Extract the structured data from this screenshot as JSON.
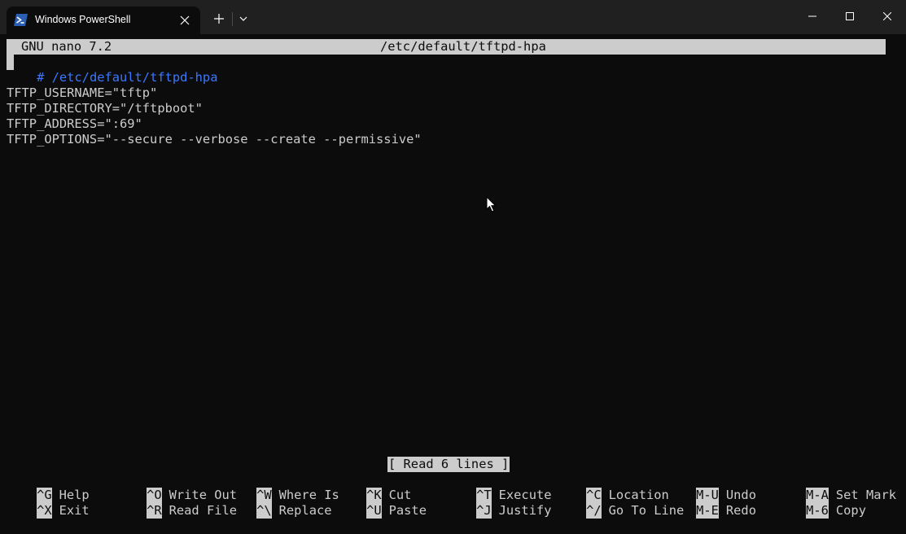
{
  "window": {
    "tab_title": "Windows PowerShell"
  },
  "nano": {
    "version": "GNU nano 7.2",
    "filename": "/etc/default/tftpd-hpa",
    "lines": [
      "# /etc/default/tftpd-hpa",
      "",
      "TFTP_USERNAME=\"tftp\"",
      "TFTP_DIRECTORY=\"/tftpboot\"",
      "TFTP_ADDRESS=\":69\"",
      "TFTP_OPTIONS=\"--secure --verbose --create --permissive\""
    ],
    "status": "[ Read 6 lines ]",
    "shortcuts_row1": [
      {
        "key": "^G",
        "label": "Help"
      },
      {
        "key": "^O",
        "label": "Write Out"
      },
      {
        "key": "^W",
        "label": "Where Is"
      },
      {
        "key": "^K",
        "label": "Cut"
      },
      {
        "key": "^T",
        "label": "Execute"
      },
      {
        "key": "^C",
        "label": "Location"
      },
      {
        "key": "M-U",
        "label": "Undo"
      },
      {
        "key": "M-A",
        "label": "Set Mark"
      }
    ],
    "shortcuts_row2": [
      {
        "key": "^X",
        "label": "Exit"
      },
      {
        "key": "^R",
        "label": "Read File"
      },
      {
        "key": "^\\",
        "label": "Replace"
      },
      {
        "key": "^U",
        "label": "Paste"
      },
      {
        "key": "^J",
        "label": "Justify"
      },
      {
        "key": "^/",
        "label": "Go To Line"
      },
      {
        "key": "M-E",
        "label": "Redo"
      },
      {
        "key": "M-6",
        "label": "Copy"
      }
    ]
  },
  "icons": {
    "tab_icon": "powershell-icon",
    "tab_close": "close-icon",
    "new_tab": "plus-icon",
    "dropdown": "chevron-down-icon",
    "minimize": "minimize-icon",
    "maximize": "maximize-icon",
    "close": "close-icon",
    "pointer": "mouse-pointer-icon"
  },
  "colors": {
    "terminal_bg": "#0c0c0c",
    "terminal_fg": "#cccccc",
    "comment": "#3b78ff",
    "titlebar": "#202020",
    "powershell_blue": "#2b5fb3"
  }
}
